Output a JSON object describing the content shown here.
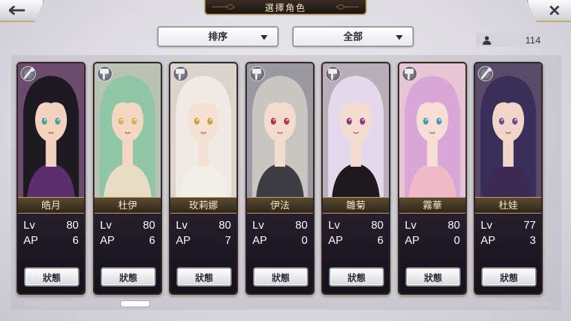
{
  "header": {
    "title": "選擇角色"
  },
  "toolbar": {
    "sort_label": "排序",
    "filter_label": "全部",
    "character_count": "114"
  },
  "characters": [
    {
      "name": "皓月",
      "lv_label": "Lv",
      "lv": "80",
      "ap_label": "AP",
      "ap": "6",
      "status_label": "狀態",
      "class_icon": "staff-class-icon",
      "hair": "#1d1a22",
      "skin": "#f3d3c0",
      "eyes": "#3fa79a",
      "outfit": "#5b2f6b",
      "bg": "#6b4b6e"
    },
    {
      "name": "杜伊",
      "lv_label": "Lv",
      "lv": "80",
      "ap_label": "AP",
      "ap": "6",
      "status_label": "狀態",
      "class_icon": "hammer-class-icon",
      "hair": "#8fc7a6",
      "skin": "#f3d7c3",
      "eyes": "#d9b24a",
      "outfit": "#e8dcc4",
      "bg": "#b9c3b5"
    },
    {
      "name": "玫莉娜",
      "lv_label": "Lv",
      "lv": "80",
      "ap_label": "AP",
      "ap": "7",
      "status_label": "狀態",
      "class_icon": "hammer-class-icon",
      "hair": "#efebe4",
      "skin": "#f6e2d5",
      "eyes": "#c9a437",
      "outfit": "#f2efe9",
      "bg": "#d9d4cc"
    },
    {
      "name": "伊法",
      "lv_label": "Lv",
      "lv": "80",
      "ap_label": "AP",
      "ap": "0",
      "status_label": "狀態",
      "class_icon": "hammer-class-icon",
      "hair": "#c9c6c2",
      "skin": "#f2dccd",
      "eyes": "#b8344a",
      "outfit": "#3e3c44",
      "bg": "#9a98a1"
    },
    {
      "name": "雛菊",
      "lv_label": "Lv",
      "lv": "80",
      "ap_label": "AP",
      "ap": "6",
      "status_label": "狀態",
      "class_icon": "hammer-class-icon",
      "hair": "#e3d8ec",
      "skin": "#f4dcd0",
      "eyes": "#8e3a7a",
      "outfit": "#1e1a20",
      "bg": "#b8aeba"
    },
    {
      "name": "霧華",
      "lv_label": "Lv",
      "lv": "80",
      "ap_label": "AP",
      "ap": "0",
      "status_label": "狀態",
      "class_icon": "hammer-class-icon",
      "hair": "#d9a6d8",
      "skin": "#f7ddd6",
      "eyes": "#3e9fb0",
      "outfit": "#f0b9c8",
      "bg": "#e6c6d5"
    },
    {
      "name": "杜娃",
      "lv_label": "Lv",
      "lv": "77",
      "ap_label": "AP",
      "ap": "3",
      "status_label": "狀態",
      "class_icon": "staff-class-icon",
      "hair": "#3a2e5a",
      "skin": "#f1d5c8",
      "eyes": "#6b4d8a",
      "outfit": "#3c2a52",
      "bg": "#5a4a6a"
    }
  ]
}
